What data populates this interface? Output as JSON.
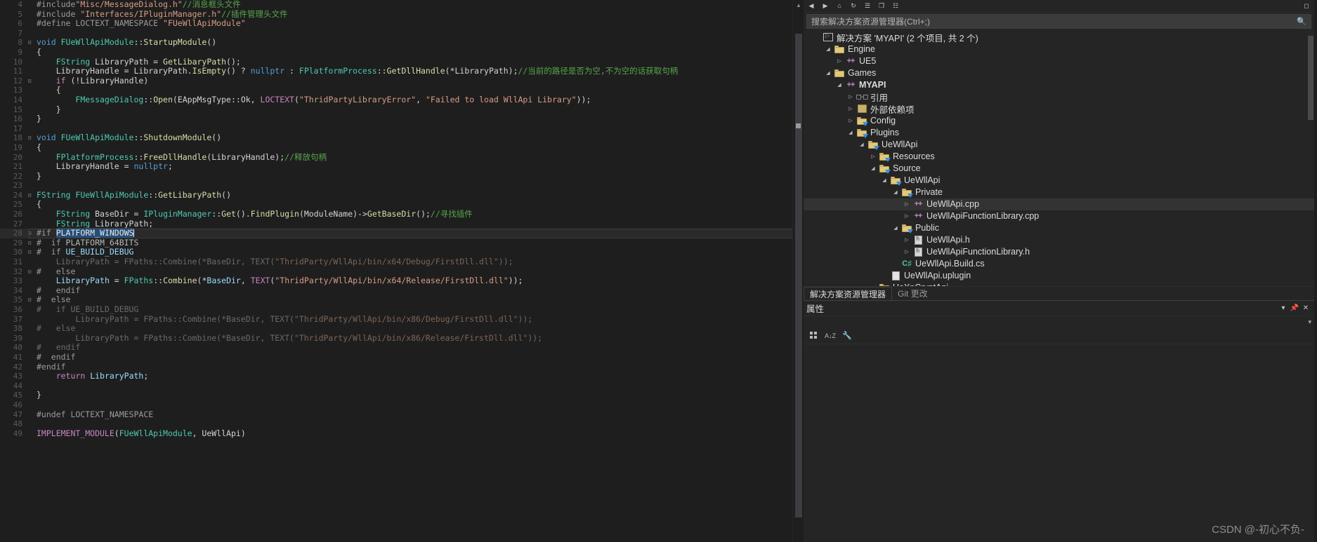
{
  "window": {
    "watermark": "CSDN @-初心不负-"
  },
  "editor": {
    "language": "cpp",
    "filename": "UeWllApi.cpp",
    "first_line": 4,
    "lines": [
      {
        "n": 4,
        "fold": "",
        "tokens": [
          {
            "t": "#include",
            "c": "pre"
          },
          {
            "t": "\"Misc/MessageDialog.h\"",
            "c": "str"
          },
          {
            "t": "//消息框头文件",
            "c": "cmt"
          }
        ]
      },
      {
        "n": 5,
        "fold": "",
        "tokens": [
          {
            "t": "#include ",
            "c": "pre"
          },
          {
            "t": "\"Interfaces/IPluginManager.h\"",
            "c": "str"
          },
          {
            "t": "//插件管理头文件",
            "c": "cmt"
          }
        ]
      },
      {
        "n": 6,
        "fold": "",
        "tokens": [
          {
            "t": "#define LOCTEXT_NAMESPACE ",
            "c": "pre"
          },
          {
            "t": "\"FUeWllApiModule\"",
            "c": "str"
          }
        ]
      },
      {
        "n": 7,
        "fold": "",
        "tokens": []
      },
      {
        "n": 8,
        "fold": "-",
        "tokens": [
          {
            "t": "void ",
            "c": "kw"
          },
          {
            "t": "FUeWllApiModule",
            "c": "type"
          },
          {
            "t": "::",
            "c": "punc"
          },
          {
            "t": "StartupModule",
            "c": "fn"
          },
          {
            "t": "()",
            "c": "punc"
          }
        ]
      },
      {
        "n": 9,
        "fold": "",
        "tokens": [
          {
            "t": "{",
            "c": "punc"
          }
        ]
      },
      {
        "n": 10,
        "fold": "",
        "tokens": [
          {
            "t": "    ",
            "c": "plain"
          },
          {
            "t": "FString",
            "c": "type"
          },
          {
            "t": " LibraryPath = ",
            "c": "plain"
          },
          {
            "t": "GetLibaryPath",
            "c": "fn"
          },
          {
            "t": "();",
            "c": "punc"
          }
        ]
      },
      {
        "n": 11,
        "fold": "",
        "tokens": [
          {
            "t": "    LibraryHandle = LibraryPath.",
            "c": "plain"
          },
          {
            "t": "IsEmpty",
            "c": "fn"
          },
          {
            "t": "() ? ",
            "c": "punc"
          },
          {
            "t": "nullptr",
            "c": "kw"
          },
          {
            "t": " : ",
            "c": "punc"
          },
          {
            "t": "FPlatformProcess",
            "c": "type"
          },
          {
            "t": "::",
            "c": "punc"
          },
          {
            "t": "GetDllHandle",
            "c": "fn"
          },
          {
            "t": "(*LibraryPath);",
            "c": "punc"
          },
          {
            "t": "//当前的路径是否为空,不为空的话获取句柄",
            "c": "cmt"
          }
        ]
      },
      {
        "n": 12,
        "fold": "-",
        "tokens": [
          {
            "t": "    ",
            "c": "plain"
          },
          {
            "t": "if",
            "c": "kw2"
          },
          {
            "t": " (!LibraryHandle)",
            "c": "plain"
          }
        ]
      },
      {
        "n": 13,
        "fold": "",
        "tokens": [
          {
            "t": "    {",
            "c": "punc"
          }
        ]
      },
      {
        "n": 14,
        "fold": "",
        "tokens": [
          {
            "t": "        ",
            "c": "plain"
          },
          {
            "t": "FMessageDialog",
            "c": "type"
          },
          {
            "t": "::",
            "c": "punc"
          },
          {
            "t": "Open",
            "c": "fn"
          },
          {
            "t": "(EAppMsgType::Ok, ",
            "c": "plain"
          },
          {
            "t": "LOCTEXT",
            "c": "kw2"
          },
          {
            "t": "(",
            "c": "punc"
          },
          {
            "t": "\"ThridPartyLibraryError\"",
            "c": "str"
          },
          {
            "t": ", ",
            "c": "punc"
          },
          {
            "t": "\"Failed to load WllApi Library\"",
            "c": "str"
          },
          {
            "t": "));",
            "c": "punc"
          }
        ]
      },
      {
        "n": 15,
        "fold": "",
        "tokens": [
          {
            "t": "    }",
            "c": "punc"
          }
        ]
      },
      {
        "n": 16,
        "fold": "",
        "tokens": [
          {
            "t": "}",
            "c": "punc"
          }
        ]
      },
      {
        "n": 17,
        "fold": "",
        "tokens": []
      },
      {
        "n": 18,
        "fold": "-",
        "tokens": [
          {
            "t": "void ",
            "c": "kw"
          },
          {
            "t": "FUeWllApiModule",
            "c": "type"
          },
          {
            "t": "::",
            "c": "punc"
          },
          {
            "t": "ShutdownModule",
            "c": "fn"
          },
          {
            "t": "()",
            "c": "punc"
          }
        ]
      },
      {
        "n": 19,
        "fold": "",
        "tokens": [
          {
            "t": "{",
            "c": "punc"
          }
        ]
      },
      {
        "n": 20,
        "fold": "",
        "tokens": [
          {
            "t": "    ",
            "c": "plain"
          },
          {
            "t": "FPlatformProcess",
            "c": "type"
          },
          {
            "t": "::",
            "c": "punc"
          },
          {
            "t": "FreeDllHandle",
            "c": "fn"
          },
          {
            "t": "(LibraryHandle);",
            "c": "punc"
          },
          {
            "t": "//释放句柄",
            "c": "cmt"
          }
        ]
      },
      {
        "n": 21,
        "fold": "",
        "tokens": [
          {
            "t": "    LibraryHandle = ",
            "c": "plain"
          },
          {
            "t": "nullptr",
            "c": "kw"
          },
          {
            "t": ";",
            "c": "punc"
          }
        ]
      },
      {
        "n": 22,
        "fold": "",
        "tokens": [
          {
            "t": "}",
            "c": "punc"
          }
        ]
      },
      {
        "n": 23,
        "fold": "",
        "tokens": []
      },
      {
        "n": 24,
        "fold": "-",
        "tokens": [
          {
            "t": "FString",
            "c": "type"
          },
          {
            "t": " ",
            "c": "plain"
          },
          {
            "t": "FUeWllApiModule",
            "c": "type"
          },
          {
            "t": "::",
            "c": "punc"
          },
          {
            "t": "GetLibaryPath",
            "c": "fn"
          },
          {
            "t": "()",
            "c": "punc"
          }
        ]
      },
      {
        "n": 25,
        "fold": "",
        "tokens": [
          {
            "t": "{",
            "c": "punc"
          }
        ]
      },
      {
        "n": 26,
        "fold": "",
        "tokens": [
          {
            "t": "    ",
            "c": "plain"
          },
          {
            "t": "FString",
            "c": "type"
          },
          {
            "t": " BaseDir = ",
            "c": "plain"
          },
          {
            "t": "IPluginManager",
            "c": "type"
          },
          {
            "t": "::",
            "c": "punc"
          },
          {
            "t": "Get",
            "c": "fn"
          },
          {
            "t": "().",
            "c": "punc"
          },
          {
            "t": "FindPlugin",
            "c": "fn"
          },
          {
            "t": "(ModuleName)->",
            "c": "punc"
          },
          {
            "t": "GetBaseDir",
            "c": "fn"
          },
          {
            "t": "();",
            "c": "punc"
          },
          {
            "t": "//寻找插件",
            "c": "cmt"
          }
        ]
      },
      {
        "n": 27,
        "fold": "",
        "tokens": [
          {
            "t": "    ",
            "c": "plain"
          },
          {
            "t": "FString",
            "c": "type"
          },
          {
            "t": " LibraryPath;",
            "c": "plain"
          }
        ]
      },
      {
        "n": 28,
        "fold": "-",
        "selected": true,
        "tokens": [
          {
            "t": "#if ",
            "c": "pre"
          },
          {
            "t": "PLATFORM_WINDOWS",
            "c": "sel"
          },
          {
            "t": "|",
            "c": "caret"
          }
        ]
      },
      {
        "n": 29,
        "fold": "-",
        "tokens": [
          {
            "t": "#  if ",
            "c": "pre"
          },
          {
            "t": "PLATFORM_64BITS",
            "c": "macro"
          }
        ]
      },
      {
        "n": 30,
        "fold": "-",
        "tokens": [
          {
            "t": "#  if ",
            "c": "pre"
          },
          {
            "t": "UE_BUILD_DEBUG",
            "c": "ident"
          }
        ]
      },
      {
        "n": 31,
        "fold": "",
        "tokens": [
          {
            "t": "    LibraryPath = FPaths::Combine(*BaseDir, TEXT(",
            "c": "dim"
          },
          {
            "t": "\"ThridParty/WllApi/bin/x64/Debug/FirstDll.dll\"",
            "c": "dimstr"
          },
          {
            "t": "));",
            "c": "dim"
          }
        ]
      },
      {
        "n": 32,
        "fold": "-",
        "tokens": [
          {
            "t": "#   else",
            "c": "pre"
          }
        ]
      },
      {
        "n": 33,
        "fold": "",
        "tokens": [
          {
            "t": "    ",
            "c": "plain"
          },
          {
            "t": "LibraryPath",
            "c": "ident"
          },
          {
            "t": " = ",
            "c": "plain"
          },
          {
            "t": "FPaths",
            "c": "type"
          },
          {
            "t": "::",
            "c": "punc"
          },
          {
            "t": "Combine",
            "c": "fn"
          },
          {
            "t": "(*",
            "c": "punc"
          },
          {
            "t": "BaseDir",
            "c": "ident"
          },
          {
            "t": ", ",
            "c": "punc"
          },
          {
            "t": "TEXT",
            "c": "kw2"
          },
          {
            "t": "(",
            "c": "punc"
          },
          {
            "t": "\"ThridParty/WllApi/bin/x64/Release/FirstDll.dll\"",
            "c": "str"
          },
          {
            "t": "));",
            "c": "punc"
          }
        ]
      },
      {
        "n": 34,
        "fold": "",
        "tokens": [
          {
            "t": "#   endif",
            "c": "pre"
          }
        ]
      },
      {
        "n": 35,
        "fold": "-",
        "tokens": [
          {
            "t": "#  else",
            "c": "pre"
          }
        ]
      },
      {
        "n": 36,
        "fold": "",
        "tokens": [
          {
            "t": "#   if UE_BUILD_DEBUG",
            "c": "dim"
          }
        ]
      },
      {
        "n": 37,
        "fold": "",
        "tokens": [
          {
            "t": "        LibraryPath = FPaths::Combine(*BaseDir, TEXT(",
            "c": "dim"
          },
          {
            "t": "\"ThridParty/WllApi/bin/x86/Debug/FirstDll.dll\"",
            "c": "dimstr"
          },
          {
            "t": "));",
            "c": "dim"
          }
        ]
      },
      {
        "n": 38,
        "fold": "",
        "tokens": [
          {
            "t": "#   else",
            "c": "dim"
          }
        ]
      },
      {
        "n": 39,
        "fold": "",
        "tokens": [
          {
            "t": "        LibraryPath = FPaths::Combine(*BaseDir, TEXT(",
            "c": "dim"
          },
          {
            "t": "\"ThridParty/WllApi/bin/x86/Release/FirstDll.dll\"",
            "c": "dimstr"
          },
          {
            "t": "));",
            "c": "dim"
          }
        ]
      },
      {
        "n": 40,
        "fold": "",
        "tokens": [
          {
            "t": "#   endif",
            "c": "dim"
          }
        ]
      },
      {
        "n": 41,
        "fold": "",
        "tokens": [
          {
            "t": "#  endif",
            "c": "pre"
          }
        ]
      },
      {
        "n": 42,
        "fold": "",
        "tokens": [
          {
            "t": "#endif",
            "c": "pre"
          }
        ]
      },
      {
        "n": 43,
        "fold": "",
        "tokens": [
          {
            "t": "    ",
            "c": "plain"
          },
          {
            "t": "return",
            "c": "kw2"
          },
          {
            "t": " ",
            "c": "plain"
          },
          {
            "t": "LibraryPath",
            "c": "ident"
          },
          {
            "t": ";",
            "c": "punc"
          }
        ]
      },
      {
        "n": 44,
        "fold": "",
        "tokens": []
      },
      {
        "n": 45,
        "fold": "",
        "tokens": [
          {
            "t": "}",
            "c": "punc"
          }
        ]
      },
      {
        "n": 46,
        "fold": "",
        "tokens": []
      },
      {
        "n": 47,
        "fold": "",
        "tokens": [
          {
            "t": "#undef LOCTEXT_NAMESPACE",
            "c": "pre"
          }
        ]
      },
      {
        "n": 48,
        "fold": "",
        "tokens": []
      },
      {
        "n": 49,
        "fold": "",
        "tokens": [
          {
            "t": "IMPLEMENT_MODULE",
            "c": "kw2"
          },
          {
            "t": "(",
            "c": "punc"
          },
          {
            "t": "FUeWllApiModule",
            "c": "type"
          },
          {
            "t": ", UeWllApi)",
            "c": "punc"
          }
        ]
      }
    ]
  },
  "solution_explorer": {
    "toolbar_icons": [
      "back-icon",
      "forward-icon",
      "home-icon",
      "refresh-icon",
      "collapse-all-icon",
      "show-all-files-icon",
      "properties-icon",
      "preview-icon"
    ],
    "search_placeholder": "搜索解决方案资源管理器(Ctrl+;)",
    "search_icon": "search-icon",
    "tree": [
      {
        "label": "解决方案 'MYAPI' (2 个项目, 共 2 个)",
        "indent": 0,
        "expander": "",
        "icon": "solution-icon",
        "bold": false,
        "selected": false
      },
      {
        "label": "Engine",
        "indent": 1,
        "expander": "▾",
        "icon": "folder-plain",
        "bold": false,
        "selected": false
      },
      {
        "label": "UE5",
        "indent": 2,
        "expander": "▸",
        "icon": "cpp-icon",
        "bold": false,
        "selected": false
      },
      {
        "label": "Games",
        "indent": 1,
        "expander": "▾",
        "icon": "folder-plain",
        "bold": false,
        "selected": false
      },
      {
        "label": "MYAPI",
        "indent": 2,
        "expander": "▾",
        "icon": "cpp-icon",
        "bold": true,
        "selected": false
      },
      {
        "label": "引用",
        "indent": 3,
        "expander": "▸",
        "icon": "references-icon",
        "bold": false,
        "selected": false
      },
      {
        "label": "外部依赖项",
        "indent": 3,
        "expander": "▸",
        "icon": "extdeps-icon",
        "bold": false,
        "selected": false
      },
      {
        "label": "Config",
        "indent": 3,
        "expander": "▸",
        "icon": "folder-filter",
        "bold": false,
        "selected": false
      },
      {
        "label": "Plugins",
        "indent": 3,
        "expander": "▾",
        "icon": "folder-filter",
        "bold": false,
        "selected": false
      },
      {
        "label": "UeWllApi",
        "indent": 4,
        "expander": "▾",
        "icon": "folder-filter",
        "bold": false,
        "selected": false
      },
      {
        "label": "Resources",
        "indent": 5,
        "expander": "▸",
        "icon": "folder-filter",
        "bold": false,
        "selected": false
      },
      {
        "label": "Source",
        "indent": 5,
        "expander": "▾",
        "icon": "folder-filter",
        "bold": false,
        "selected": false
      },
      {
        "label": "UeWllApi",
        "indent": 6,
        "expander": "▾",
        "icon": "folder-filter",
        "bold": false,
        "selected": false
      },
      {
        "label": "Private",
        "indent": 7,
        "expander": "▾",
        "icon": "folder-filter",
        "bold": false,
        "selected": false
      },
      {
        "label": "UeWllApi.cpp",
        "indent": 8,
        "expander": "▸",
        "icon": "cpp-icon",
        "bold": false,
        "selected": true
      },
      {
        "label": "UeWllApiFunctionLibrary.cpp",
        "indent": 8,
        "expander": "▸",
        "icon": "cpp-icon",
        "bold": false,
        "selected": false
      },
      {
        "label": "Public",
        "indent": 7,
        "expander": "▾",
        "icon": "folder-filter",
        "bold": false,
        "selected": false
      },
      {
        "label": "UeWllApi.h",
        "indent": 8,
        "expander": "▸",
        "icon": "header-icon",
        "bold": false,
        "selected": false
      },
      {
        "label": "UeWllApiFunctionLibrary.h",
        "indent": 8,
        "expander": "▸",
        "icon": "header-icon",
        "bold": false,
        "selected": false
      },
      {
        "label": "UeWllApi.Build.cs",
        "indent": 7,
        "expander": "",
        "icon": "csharp-icon",
        "bold": false,
        "selected": false
      },
      {
        "label": "UeWllApi.uplugin",
        "indent": 6,
        "expander": "",
        "icon": "doc-icon",
        "bold": false,
        "selected": false
      },
      {
        "label": "UeXpCryptApi",
        "indent": 5,
        "expander": "▾",
        "icon": "folder-filter",
        "bold": false,
        "selected": false
      }
    ],
    "tabs": [
      {
        "label": "解决方案资源管理器",
        "active": true
      },
      {
        "label": "Git 更改",
        "active": false
      }
    ]
  },
  "properties": {
    "title": "属性",
    "dropdown_icon": "chevron-down-icon",
    "pin_icon": "pin-icon",
    "close_icon": "close-icon",
    "scroll_icon": "chevron-down-icon",
    "toolbar": [
      {
        "name": "categorized-view-button",
        "glyph": "grid"
      },
      {
        "name": "alphabetical-sort-button",
        "glyph": "az"
      },
      {
        "name": "property-pages-button",
        "glyph": "wrench"
      }
    ]
  }
}
